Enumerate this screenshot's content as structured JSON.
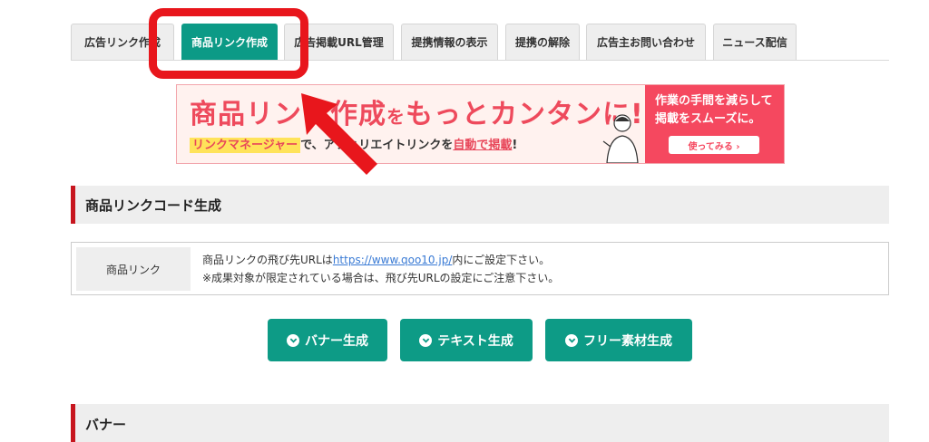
{
  "tabs": [
    {
      "label": "広告リンク作成",
      "active": false
    },
    {
      "label": "商品リンク作成",
      "active": true
    },
    {
      "label": "広告掲載URL管理",
      "active": false
    },
    {
      "label": "提携情報の表示",
      "active": false
    },
    {
      "label": "提携の解除",
      "active": false
    },
    {
      "label": "広告主お問い合わせ",
      "active": false
    },
    {
      "label": "ニュース配信",
      "active": false
    }
  ],
  "banner": {
    "headline_1": "商品リンク作成",
    "headline_2": "を",
    "headline_3": "もっとカンタンに!",
    "sub_highlight": "リンクマネージャー",
    "sub_1": "で、アフィリエイトリンクを",
    "sub_underline": "自動で掲載",
    "sub_2": "!",
    "right_line1": "作業の手間を減らして",
    "right_line2": "掲載をスムーズに。",
    "cta": "使ってみる ›"
  },
  "section1": {
    "title": "商品リンクコード生成"
  },
  "product_link": {
    "label": "商品リンク",
    "desc_before": "商品リンクの飛び先URLは",
    "desc_link": "https://www.qoo10.jp/",
    "desc_after": "内にご設定下さい。",
    "note": "※成果対象が限定されている場合は、飛び先URLの設定にご注意下さい。"
  },
  "buttons": {
    "banner": "バナー生成",
    "text": "テキスト生成",
    "free": "フリー素材生成"
  },
  "section2": {
    "title": "バナー"
  },
  "colors": {
    "accent": "#0c9a86",
    "highlight": "#e8161c",
    "section_bar": "#c7161f"
  }
}
